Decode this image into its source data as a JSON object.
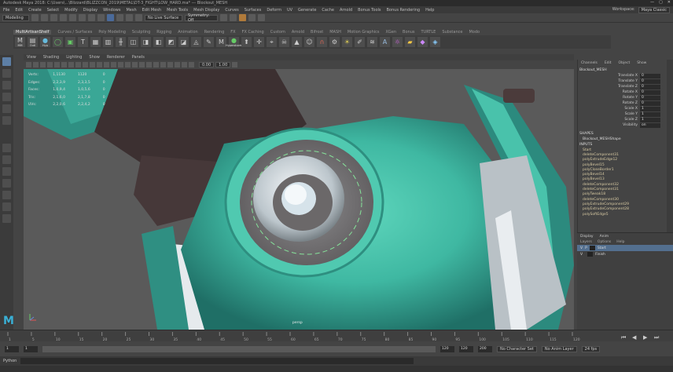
{
  "window": {
    "title": "Autodesk Maya 2018: C:\\Users\\...\\Blizzard\\BLIZZCON_2019\\METAL\\DT-3_FIGHT\\LOW_HARD.ma*   ---   Blockout_MESH",
    "controls": [
      "—",
      "▢",
      "✕"
    ]
  },
  "menubar": {
    "items": [
      "File",
      "Edit",
      "Create",
      "Select",
      "Modify",
      "Display",
      "Windows",
      "Mesh",
      "Edit Mesh",
      "Mesh Tools",
      "Mesh Display",
      "Curves",
      "Surfaces",
      "Deform",
      "UV",
      "Generate",
      "Cache",
      "Arnold",
      "Bonus Tools",
      "Bonus Rendering",
      "Help"
    ],
    "workspace_label": "Workspace:",
    "workspace_value": "Maya Classic"
  },
  "statusline": {
    "mode": "Modeling",
    "live_surface": "No Live Surface",
    "symmetry": "Symmetry: Off"
  },
  "shelf": {
    "tabs": [
      "MultiArtisanShelf",
      "Curves / Surfaces",
      "Poly Modeling",
      "Sculpting",
      "Rigging",
      "Animation",
      "Rendering",
      "FX",
      "FX Caching",
      "Custom",
      "Arnold",
      "Bifrost",
      "MASH",
      "Motion Graphics",
      "XGen",
      "Bonus",
      "TURTLE",
      "Substance",
      "Modo",
      "MayaScripting",
      "Arnold2"
    ],
    "active_tab": "MultiArtisanShelf",
    "buttons": [
      "MM",
      "Outl",
      "Hyp",
      "",
      "",
      "",
      "",
      "",
      "",
      "",
      "",
      "",
      "",
      "",
      "",
      "",
      "",
      "",
      "",
      "Hypershade",
      "",
      "",
      "",
      "",
      "",
      "",
      "",
      "",
      "",
      "",
      "",
      "",
      "",
      "",
      "",
      "",
      "",
      "",
      "",
      "",
      "",
      "",
      ""
    ]
  },
  "viewport": {
    "menu": [
      "View",
      "Shading",
      "Lighting",
      "Show",
      "Renderer",
      "Panels"
    ],
    "camera": "persp",
    "hud": [
      [
        "Verts:",
        "1,1130",
        "1120",
        "0"
      ],
      [
        "Edges:",
        "2,2,3,9",
        "2,3,3,5",
        "0"
      ],
      [
        "Faces:",
        "1,0,9,4",
        "1,0,5,6",
        "0"
      ],
      [
        "Tris:",
        "2,1,6,0",
        "2,1,7,8",
        "0"
      ],
      [
        "UVs:",
        "2,2,0,6",
        "2,2,4,2",
        "0"
      ]
    ],
    "gate_value": "0.00",
    "scale_value": "1.00",
    "colors": {
      "teal": "#3fb8a2",
      "teal_dark": "#1f6f66",
      "dark_metal": "#3a2f30",
      "light_metal": "#cfd6db",
      "background": "#5c5c5c"
    }
  },
  "channel_box": {
    "menu": [
      "Channels",
      "Edit",
      "Object",
      "Show"
    ],
    "object": "Blockout_MESH",
    "attributes": [
      {
        "name": "Translate X",
        "value": "0"
      },
      {
        "name": "Translate Y",
        "value": "0"
      },
      {
        "name": "Translate Z",
        "value": "0"
      },
      {
        "name": "Rotate X",
        "value": "0"
      },
      {
        "name": "Rotate Y",
        "value": "0"
      },
      {
        "name": "Rotate Z",
        "value": "0"
      },
      {
        "name": "Scale X",
        "value": "1"
      },
      {
        "name": "Scale Y",
        "value": "1"
      },
      {
        "name": "Scale Z",
        "value": "1"
      },
      {
        "name": "Visibility",
        "value": "on"
      }
    ],
    "shapes_label": "SHAPES",
    "shape": "Blockout_MESHShape",
    "inputs_label": "INPUTS",
    "inputs": [
      "Start",
      "deleteComponent31",
      "polyExtrudeEdge12",
      "polyBevel15",
      "polyCloseBorder1",
      "polyBevel14",
      "polyBevel13",
      "deleteComponent32",
      "deleteComponent31",
      "polyTweak18",
      "deleteComponent30",
      "polyExtrudeComponent29",
      "polyExtrudeComponent28",
      "polySoftEdge5"
    ]
  },
  "layers": {
    "tabs": [
      "Display",
      "Anim"
    ],
    "menu": [
      "Layers",
      "Options",
      "Help"
    ],
    "items": [
      {
        "vis": "V",
        "pick": "P",
        "name": "Start",
        "selected": true
      },
      {
        "vis": "V",
        "pick": "",
        "name": "Finish",
        "selected": false
      }
    ]
  },
  "timeline": {
    "ticks": [
      "1",
      "5",
      "10",
      "15",
      "20",
      "25",
      "30",
      "35",
      "40",
      "45",
      "50",
      "55",
      "60",
      "65",
      "70",
      "75",
      "80",
      "85",
      "90",
      "95",
      "100",
      "105",
      "110",
      "115",
      "120"
    ],
    "current_frame": "1"
  },
  "range": {
    "start": "1",
    "start2": "1",
    "end": "120",
    "end2": "120",
    "end3": "200",
    "character_set": "No Character Set",
    "anim_layer": "No Anim Layer",
    "fps": "24 fps"
  },
  "command_line": {
    "label": "Python"
  }
}
